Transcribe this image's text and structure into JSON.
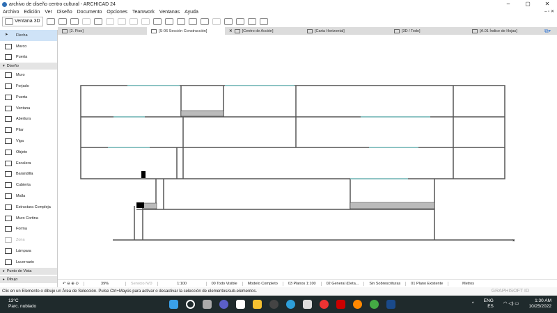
{
  "window": {
    "title": "archivo de diseño centro cultural - ARCHICAD 24",
    "controls": [
      "–",
      "▢",
      "✕"
    ]
  },
  "menu": [
    "Archivo",
    "Edición",
    "Ver",
    "Diseño",
    "Documento",
    "Opciones",
    "Teamwork",
    "Ventanas",
    "Ayuda"
  ],
  "toolbar": {
    "ventana3d": "Ventana 3D"
  },
  "tabs": [
    {
      "label": "[2. Piso]"
    },
    {
      "label": "[S-06 Sección Construcción]",
      "active": true
    },
    {
      "label": "[Centro de Acción]"
    },
    {
      "label": "[Carta Horizontal]"
    },
    {
      "label": "[3D / Todo]"
    },
    {
      "label": "[A.01 Índice de Hojas]"
    }
  ],
  "sidebar": {
    "top": [
      {
        "label": "Flecha",
        "selected": true
      },
      {
        "label": "Marco"
      },
      {
        "label": "Puerta"
      }
    ],
    "section": "Diseño",
    "items": [
      {
        "label": "Muro"
      },
      {
        "label": "Forjado"
      },
      {
        "label": "Puerta"
      },
      {
        "label": "Ventana"
      },
      {
        "label": "Abertura"
      },
      {
        "label": "Pilar"
      },
      {
        "label": "Viga"
      },
      {
        "label": "Objeto"
      },
      {
        "label": "Escalera"
      },
      {
        "label": "Barandilla"
      },
      {
        "label": "Cubierta"
      },
      {
        "label": "Malla"
      },
      {
        "label": "Estructura Compleja"
      },
      {
        "label": "Muro Cortina"
      },
      {
        "label": "Forma"
      },
      {
        "label": "Zona",
        "disabled": true
      },
      {
        "label": "Lámpara"
      },
      {
        "label": "Lucernario"
      }
    ],
    "footer": [
      "Punto de Vista",
      "Dibujo"
    ]
  },
  "status": {
    "zoom": "39%",
    "service": "Servicio N/D",
    "scale": "1:100",
    "layers": "00 Todo Visible",
    "model": "Modelo Completo",
    "pens": "03 Planos 1:100",
    "mvo": "02 General (Deta...",
    "override": "Sin Sobrescrituras",
    "renovation": "01 Plano Existente",
    "units": "Metros"
  },
  "message": "Clic en un Elemento o dibuje un Área de Selección. Pulse Ctrl+Mayús para activar o desactivar la selección de elementos/sub-elementos.",
  "graphisoft": "GRAPHISOFT ID",
  "taskbar": {
    "temp": "13°C",
    "weather": "Parc. nublado",
    "lang1": "ENG",
    "lang2": "ES",
    "time": "1:30 AM",
    "date": "10/25/2022"
  }
}
